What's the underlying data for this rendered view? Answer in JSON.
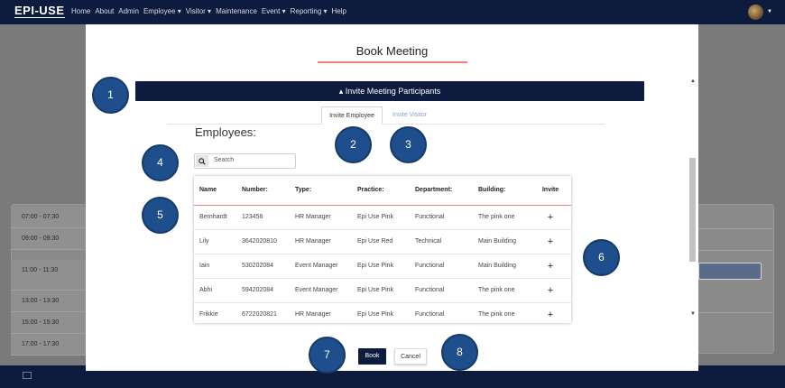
{
  "topnav": {
    "logo": "EPI-USE",
    "links": [
      "Home",
      "About",
      "Admin",
      "Employee ▾",
      "Visitor ▾",
      "Maintenance",
      "Event ▾",
      "Reporting ▾",
      "Help"
    ]
  },
  "background": {
    "time_slots": [
      "07:00 - 07:30",
      "09:00 - 09:30",
      "11:00 - 11:30",
      "13:00 - 13:30",
      "15:00 - 15:30",
      "17:00 - 17:30"
    ]
  },
  "modal": {
    "title": "Book Meeting",
    "section_label": "▴ Invite Meeting Participants",
    "tabs": [
      "Invite Employee",
      "Invite Visitor"
    ],
    "employees_heading": "Employees:",
    "search_placeholder": "Search",
    "table": {
      "headers": [
        "Name",
        "Number:",
        "Type:",
        "Practice:",
        "Department:",
        "Building:",
        "Invite"
      ],
      "rows": [
        [
          "Bernhardt",
          "123456",
          "HR Manager",
          "Epi Use Pink",
          "Functional",
          "The pink one",
          "+"
        ],
        [
          "Lily",
          "3642020810",
          "HR Manager",
          "Epi Use Red",
          "Technical",
          "Main Building",
          "+"
        ],
        [
          "Iain",
          "530202084",
          "Event Manager",
          "Epi Use Pink",
          "Functional",
          "Main Building",
          "+"
        ],
        [
          "Abhi",
          "594202084",
          "Event Manager",
          "Epi Use Pink",
          "Functional",
          "The pink one",
          "+"
        ],
        [
          "Frikkie",
          "6722020821",
          "HR Manager",
          "Epi Use Pink",
          "Functional",
          "The pink one",
          "+"
        ]
      ]
    },
    "book_label": "Book",
    "cancel_label": "Cancel"
  },
  "markers": [
    "1",
    "2",
    "3",
    "4",
    "5",
    "6",
    "7",
    "8"
  ],
  "colors": {
    "navy": "#0d1b3e",
    "accent_pink": "#f08080",
    "marker_blue": "#1f4e8c"
  }
}
